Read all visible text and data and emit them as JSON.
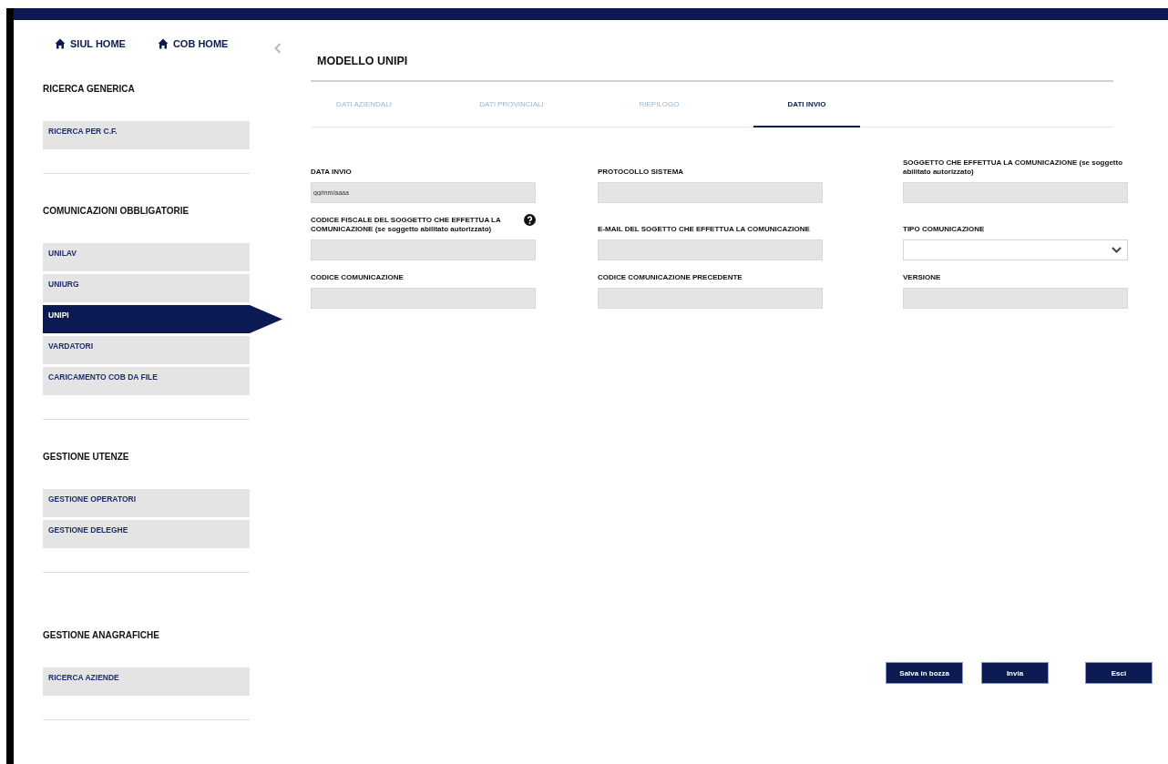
{
  "home_links": [
    {
      "label": "SIUL HOME"
    },
    {
      "label": "COB HOME"
    }
  ],
  "sidebar": {
    "sections": [
      {
        "title": "RICERCA GENERICA",
        "items": [
          {
            "label": "RICERCA PER C.F.",
            "selected": false
          }
        ]
      },
      {
        "title": "COMUNICAZIONI OBBLIGATORIE",
        "items": [
          {
            "label": "UNILAV",
            "selected": false
          },
          {
            "label": "UNIURG",
            "selected": false
          },
          {
            "label": "UNIPI",
            "selected": true
          },
          {
            "label": "VARDATORI",
            "selected": false
          },
          {
            "label": "CARICAMENTO COB DA FILE",
            "selected": false
          }
        ]
      },
      {
        "title": "GESTIONE UTENZE",
        "items": [
          {
            "label": "GESTIONE OPERATORI",
            "selected": false
          },
          {
            "label": "GESTIONE DELEGHE",
            "selected": false
          }
        ]
      },
      {
        "title": "GESTIONE ANAGRAFICHE",
        "items": [
          {
            "label": "RICERCA AZIENDE",
            "selected": false
          }
        ]
      }
    ]
  },
  "page_title": "MODELLO UNIPI",
  "tabs": [
    {
      "label": "DATI AZIENDALI",
      "selected": false
    },
    {
      "label": "DATI PROVINCIALI",
      "selected": false
    },
    {
      "label": "RIEPILOGO",
      "selected": false
    },
    {
      "label": "DATI INVIO",
      "selected": true
    }
  ],
  "fields": [
    {
      "kind": "text",
      "label": "DATA INVIO",
      "placeholder": "gg/mm/aaaa",
      "help": false
    },
    {
      "kind": "text",
      "label": "PROTOCOLLO SISTEMA",
      "help": false
    },
    {
      "kind": "text",
      "label": "SOGGETTO CHE EFFETTUA LA COMUNICAZIONE (se soggetto abilitato autorizzato)",
      "help": false
    },
    {
      "kind": "text",
      "label": "CODICE FISCALE DEL SOGGETTO CHE EFFETTUA LA COMUNICAZIONE (se soggetto abilitato autorizzato)",
      "help": true
    },
    {
      "kind": "text",
      "label": "E-MAIL DEL SOGETTO CHE EFFETTUA LA COMUNICAZIONE",
      "help": false
    },
    {
      "kind": "select",
      "label": "TIPO COMUNICAZIONE",
      "help": false
    },
    {
      "kind": "text",
      "label": "CODICE COMUNICAZIONE",
      "help": false
    },
    {
      "kind": "text",
      "label": "CODICE COMUNICAZIONE PRECEDENTE",
      "help": false
    },
    {
      "kind": "text",
      "label": "VERSIONE",
      "help": false
    }
  ],
  "buttons": [
    "Salva in bozza",
    "Invia",
    "Esci"
  ]
}
